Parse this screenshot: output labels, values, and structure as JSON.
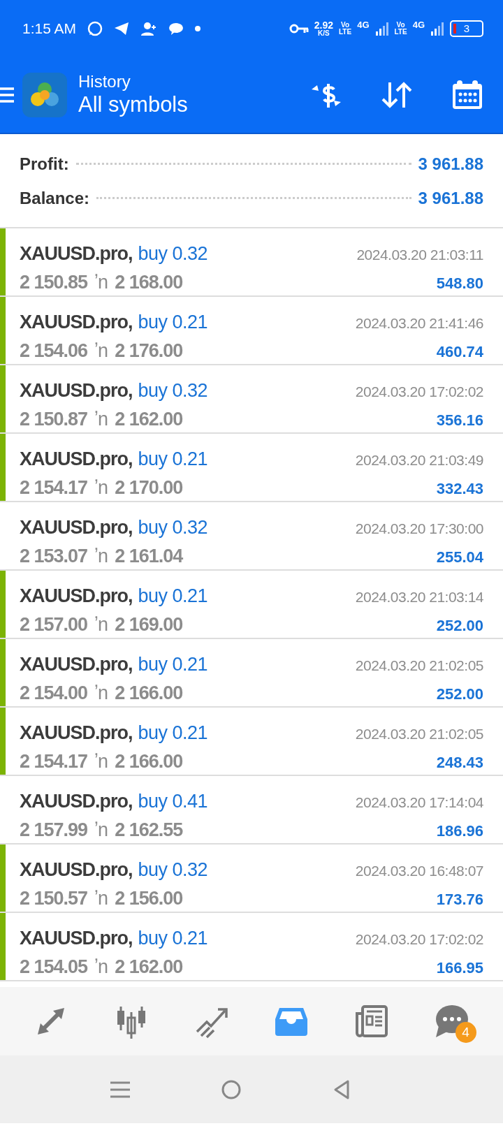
{
  "status_bar": {
    "time": "1:15 AM",
    "speed": "2.92",
    "speed_unit": "K/S",
    "sim1": "Vo\nLTE",
    "net1": "4G",
    "sim2": "Vo\nLTE",
    "net2": "4G",
    "battery": "3"
  },
  "header": {
    "title": "History",
    "subtitle": "All symbols"
  },
  "summary": [
    {
      "label": "Profit:",
      "value": "3 961.88"
    },
    {
      "label": "Balance:",
      "value": "3 961.88"
    }
  ],
  "deals": [
    {
      "symbol": "XAUUSD.pro,",
      "side": "buy 0.32",
      "open": "2 150.85",
      "arrow": "ʼn",
      "close": "2 168.00",
      "time": "2024.03.20 21:03:11",
      "profit": "548.80",
      "marked": true
    },
    {
      "symbol": "XAUUSD.pro,",
      "side": "buy 0.21",
      "open": "2 154.06",
      "arrow": "ʼn",
      "close": "2 176.00",
      "time": "2024.03.20 21:41:46",
      "profit": "460.74",
      "marked": true
    },
    {
      "symbol": "XAUUSD.pro,",
      "side": "buy 0.32",
      "open": "2 150.87",
      "arrow": "ʼn",
      "close": "2 162.00",
      "time": "2024.03.20 17:02:02",
      "profit": "356.16",
      "marked": true
    },
    {
      "symbol": "XAUUSD.pro,",
      "side": "buy 0.21",
      "open": "2 154.17",
      "arrow": "ʼn",
      "close": "2 170.00",
      "time": "2024.03.20 21:03:49",
      "profit": "332.43",
      "marked": true
    },
    {
      "symbol": "XAUUSD.pro,",
      "side": "buy 0.32",
      "open": "2 153.07",
      "arrow": "ʼn",
      "close": "2 161.04",
      "time": "2024.03.20 17:30:00",
      "profit": "255.04",
      "marked": false
    },
    {
      "symbol": "XAUUSD.pro,",
      "side": "buy 0.21",
      "open": "2 157.00",
      "arrow": "ʼn",
      "close": "2 169.00",
      "time": "2024.03.20 21:03:14",
      "profit": "252.00",
      "marked": true
    },
    {
      "symbol": "XAUUSD.pro,",
      "side": "buy 0.21",
      "open": "2 154.00",
      "arrow": "ʼn",
      "close": "2 166.00",
      "time": "2024.03.20 21:02:05",
      "profit": "252.00",
      "marked": true
    },
    {
      "symbol": "XAUUSD.pro,",
      "side": "buy 0.21",
      "open": "2 154.17",
      "arrow": "ʼn",
      "close": "2 166.00",
      "time": "2024.03.20 21:02:05",
      "profit": "248.43",
      "marked": true
    },
    {
      "symbol": "XAUUSD.pro,",
      "side": "buy 0.41",
      "open": "2 157.99",
      "arrow": "ʼn",
      "close": "2 162.55",
      "time": "2024.03.20 17:14:04",
      "profit": "186.96",
      "marked": false
    },
    {
      "symbol": "XAUUSD.pro,",
      "side": "buy 0.32",
      "open": "2 150.57",
      "arrow": "ʼn",
      "close": "2 156.00",
      "time": "2024.03.20 16:48:07",
      "profit": "173.76",
      "marked": true
    },
    {
      "symbol": "XAUUSD.pro,",
      "side": "buy 0.21",
      "open": "2 154.05",
      "arrow": "ʼn",
      "close": "2 162.00",
      "time": "2024.03.20 17:02:02",
      "profit": "166.95",
      "marked": true
    }
  ],
  "bottom_nav": [
    {
      "kind": "quotes",
      "selected": false
    },
    {
      "kind": "chart",
      "selected": false
    },
    {
      "kind": "trade",
      "selected": false
    },
    {
      "kind": "history",
      "selected": true
    },
    {
      "kind": "news",
      "selected": false
    },
    {
      "kind": "messages",
      "selected": false,
      "badge": "4"
    }
  ]
}
